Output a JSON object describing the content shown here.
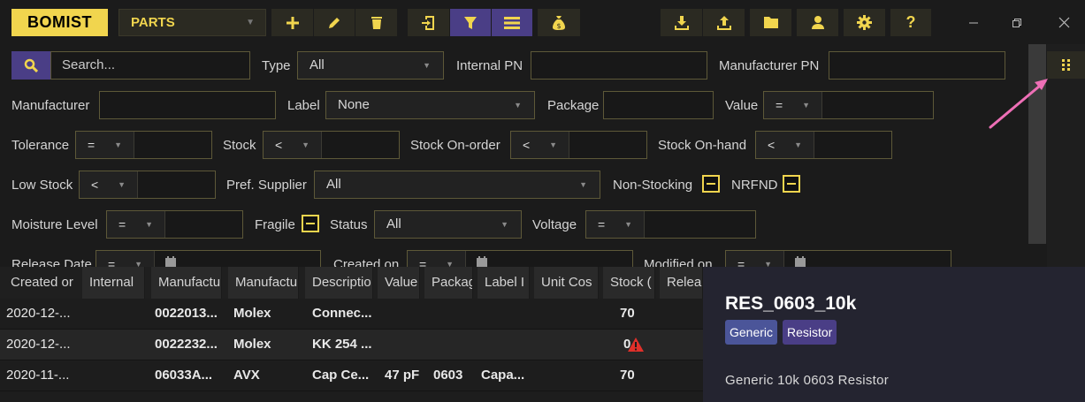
{
  "app": {
    "logo": "BOMIST",
    "mode": "PARTS"
  },
  "toolbar": {
    "buttons": [
      "add-icon",
      "edit-icon",
      "delete-icon",
      "import-icon",
      "filter-icon",
      "list-icon",
      "money-bag-icon",
      "download-icon",
      "upload-icon",
      "folder-icon",
      "user-icon",
      "settings-icon",
      "help-icon"
    ],
    "active": [
      "filter-icon",
      "list-icon"
    ],
    "help_label": "?"
  },
  "colors": {
    "accent": "#f1d54e",
    "active": "#4a3e86",
    "tag_generic": "#4b5599",
    "tag_resistor": "#4a3e86",
    "warning": "#e0302a",
    "arrow": "#ee6fb6"
  },
  "filters": {
    "search": {
      "placeholder": "Search...",
      "value": ""
    },
    "type": {
      "label": "Type",
      "value": "All"
    },
    "internal_pn": {
      "label": "Internal PN",
      "value": ""
    },
    "manufacturer_pn": {
      "label": "Manufacturer PN",
      "value": ""
    },
    "manufacturer": {
      "label": "Manufacturer",
      "value": ""
    },
    "label": {
      "label": "Label",
      "value": "None"
    },
    "package": {
      "label": "Package",
      "value": ""
    },
    "value": {
      "label": "Value",
      "op": "="
    },
    "tolerance": {
      "label": "Tolerance",
      "op": "="
    },
    "stock": {
      "label": "Stock",
      "op": "<"
    },
    "stock_on_order": {
      "label": "Stock On-order",
      "op": "<"
    },
    "stock_on_hand": {
      "label": "Stock On-hand",
      "op": "<"
    },
    "low_stock": {
      "label": "Low Stock",
      "op": "<"
    },
    "pref_supplier": {
      "label": "Pref. Supplier",
      "value": "All"
    },
    "non_stocking": {
      "label": "Non-Stocking"
    },
    "nrfnd": {
      "label": "NRFND"
    },
    "moisture_level": {
      "label": "Moisture Level",
      "op": "="
    },
    "fragile": {
      "label": "Fragile"
    },
    "status": {
      "label": "Status",
      "value": "All"
    },
    "voltage": {
      "label": "Voltage",
      "op": "="
    },
    "release_date": {
      "label": "Release Date",
      "op": "="
    },
    "created_on": {
      "label": "Created on",
      "op": "="
    },
    "modified_on": {
      "label": "Modified on",
      "op": "="
    }
  },
  "table": {
    "columns": [
      "Created or",
      "Internal",
      "Manufactu",
      "Manufactu",
      "Descriptio",
      "Value",
      "Packag",
      "Label I",
      "Unit Cos",
      "Stock (",
      "Relea"
    ],
    "rows": [
      {
        "created": "2020-12-...",
        "internal": "",
        "mpn": "0022013...",
        "manufacturer": "Molex",
        "description": "Connec...",
        "value": "",
        "package": "",
        "label": "",
        "unit_cost": "",
        "stock": "70",
        "warning": false
      },
      {
        "created": "2020-12-...",
        "internal": "",
        "mpn": "0022232...",
        "manufacturer": "Molex",
        "description": "KK 254 ...",
        "value": "",
        "package": "",
        "label": "",
        "unit_cost": "",
        "stock": "0",
        "warning": true
      },
      {
        "created": "2020-11-...",
        "internal": "",
        "mpn": "06033A...",
        "manufacturer": "AVX",
        "description": "Cap Ce...",
        "value": "47 pF",
        "package": "0603",
        "label": "Capa...",
        "unit_cost": "",
        "stock": "70",
        "warning": false
      }
    ]
  },
  "detail": {
    "title": "RES_0603_10k",
    "tags": [
      "Generic",
      "Resistor"
    ],
    "description": "Generic 10k 0603 Resistor"
  }
}
